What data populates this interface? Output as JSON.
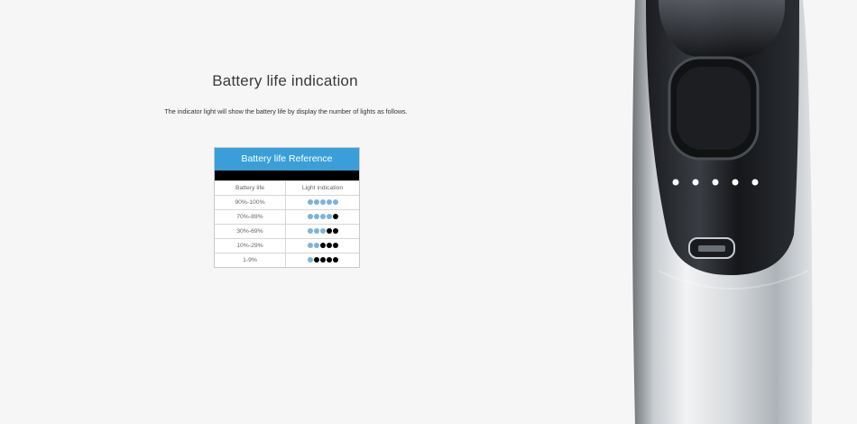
{
  "heading": "Battery life indication",
  "description": "The indicator light will show the battery life by display the number of lights as follows.",
  "reference_table": {
    "title": "Battery life Reference",
    "columns": [
      "Battery life",
      "Light indication"
    ],
    "rows": [
      {
        "range": "90%-100%",
        "lights_on": 5
      },
      {
        "range": "70%-89%",
        "lights_on": 4
      },
      {
        "range": "30%-69%",
        "lights_on": 3
      },
      {
        "range": "10%-29%",
        "lights_on": 2
      },
      {
        "range": "1-9%",
        "lights_on": 1
      }
    ],
    "total_lights": 5
  },
  "colors": {
    "background": "#f6f6f6",
    "header_blue": "#3a9fd8",
    "light_on": "#7cb3de",
    "light_off": "#000000"
  },
  "device_indicator_lights": 5
}
